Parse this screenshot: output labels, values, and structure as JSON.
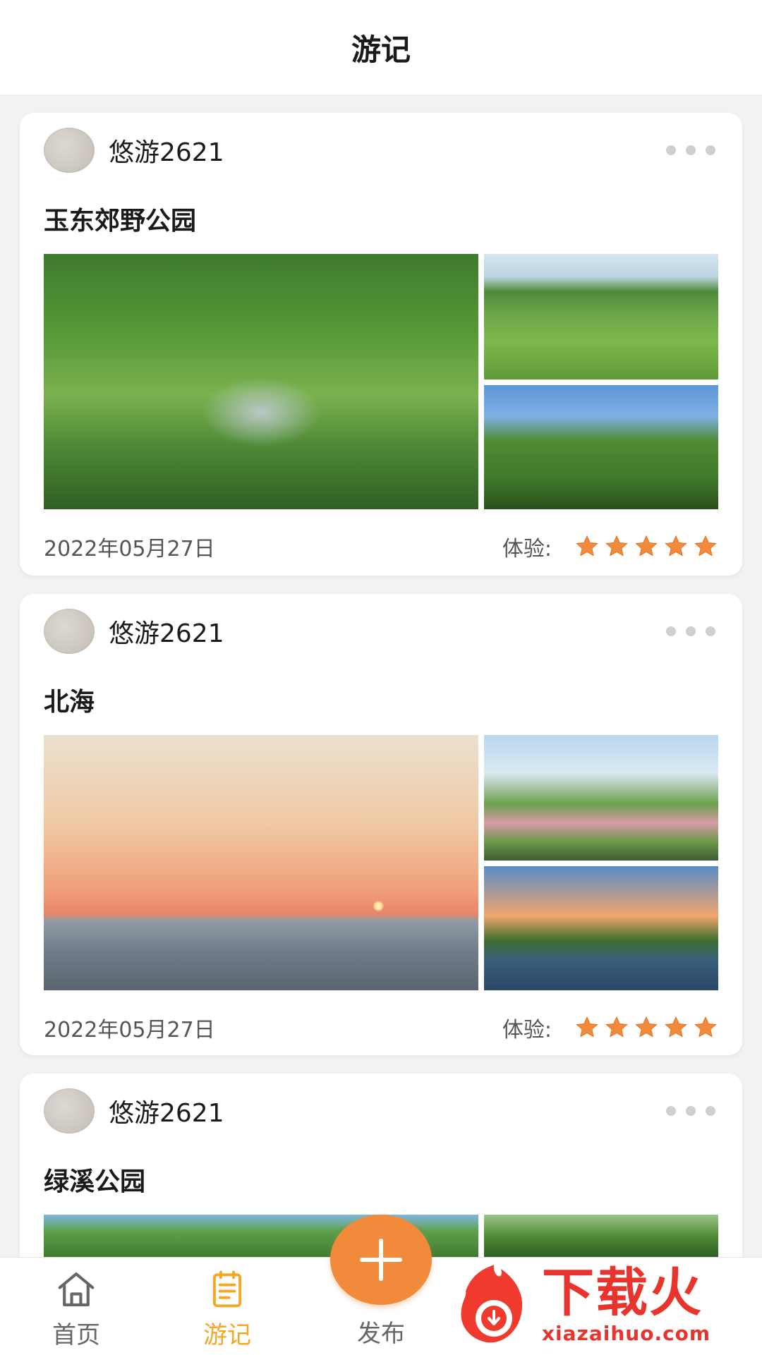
{
  "header": {
    "title": "游记"
  },
  "cards": [
    {
      "username": "悠游2621",
      "title": "玉东郊野公园",
      "date": "2022年05月27日",
      "experience_label": "体验:",
      "rating": 5
    },
    {
      "username": "悠游2621",
      "title": "北海",
      "date": "2022年05月27日",
      "experience_label": "体验:",
      "rating": 5
    },
    {
      "username": "悠游2621",
      "title": "绿溪公园"
    }
  ],
  "tabbar": {
    "items": [
      {
        "label": "首页",
        "icon": "home-icon",
        "active": false
      },
      {
        "label": "游记",
        "icon": "notes-icon",
        "active": true
      },
      {
        "label": "发布",
        "icon": "plus-icon",
        "active": false
      }
    ],
    "active_color": "#f5a623",
    "inactive_color": "#666666",
    "fab_color": "#f28a3b"
  },
  "watermark": {
    "main": "下载火",
    "sub": "xiazaihuo.com"
  },
  "colors": {
    "star": "#f28a3b"
  }
}
